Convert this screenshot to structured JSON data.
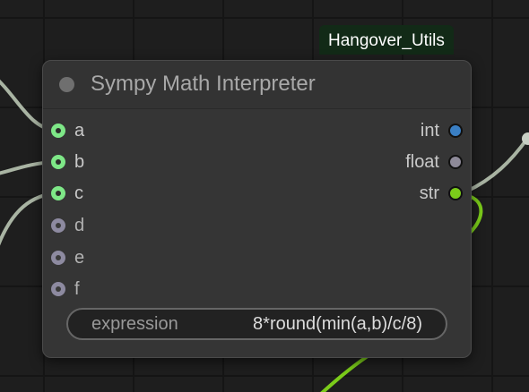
{
  "group": {
    "title": "Hangover_Utils"
  },
  "node": {
    "title": "Sympy Math Interpreter",
    "inputs": [
      {
        "label": "a",
        "connected": true
      },
      {
        "label": "b",
        "connected": true
      },
      {
        "label": "c",
        "connected": true
      },
      {
        "label": "d",
        "connected": false
      },
      {
        "label": "e",
        "connected": false
      },
      {
        "label": "f",
        "connected": false
      }
    ],
    "outputs": [
      {
        "label": "int",
        "color": "#3a7fc4"
      },
      {
        "label": "float",
        "color": "#8e8a99"
      },
      {
        "label": "str",
        "color": "#7bcc1a"
      }
    ],
    "widget": {
      "label": "expression",
      "value": "8*round(min(a,b)/c/8)"
    }
  },
  "colors": {
    "canvas": "#1e1e1e",
    "node_body": "#353535",
    "connected_input": "#7ee787",
    "wire_grey": "#a9b4a3",
    "wire_green": "#7bcc1a"
  }
}
